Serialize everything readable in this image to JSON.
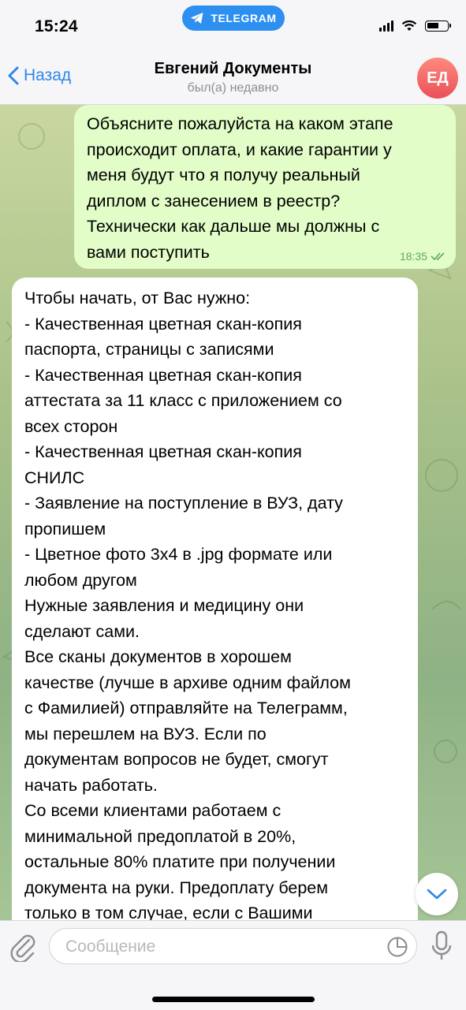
{
  "status_bar": {
    "time": "15:24",
    "app_pill": "TELEGRAM"
  },
  "header": {
    "back_label": "Назад",
    "title": "Евгений Документы",
    "subtitle": "был(а) недавно",
    "avatar_initials": "ЕД"
  },
  "messages": [
    {
      "direction": "outgoing",
      "lines": [
        "Объясните пожалуйста на каком этапе",
        "происходит оплата, и какие гарантии у",
        "меня будут что я получу реальный",
        "диплом с занесением в реестр?",
        "Технически как дальше мы должны с",
        "вами поступить"
      ],
      "time": "18:35",
      "status": "read"
    },
    {
      "direction": "incoming",
      "lines": [
        "Чтобы начать, от Вас нужно:",
        "- Качественная цветная скан-копия",
        "паспорта, страницы с записями",
        "- Качественная цветная скан-копия",
        "аттестата за 11 класс с приложением со",
        "всех сторон",
        "- Качественная цветная скан-копия",
        "СНИЛС",
        "- Заявление на поступление в ВУЗ, дату",
        "пропишем",
        "- Цветное фото 3х4 в .jpg формате или",
        "любом другом",
        "Нужные заявления и медицину они",
        "сделают сами.",
        "Все сканы документов в хорошем",
        "качестве (лучше в архиве одним файлом",
        "с Фамилией) отправляйте на Телеграмм,",
        "мы перешлем на ВУЗ. Если  по",
        "документам вопросов не будет, смогут",
        "начать работать.",
        "Со всеми клиентами работаем с",
        "минимальной предоплатой в 20%,",
        "остальные 80% платите при получении",
        "документа на руки. Предоплату берем",
        "только в том случае, если с Вашими"
      ]
    }
  ],
  "composer": {
    "placeholder": "Сообщение"
  },
  "colors": {
    "accent": "#2f86e8",
    "outgoing_bubble": "#e2fdc8",
    "incoming_bubble": "#ffffff",
    "avatar": "#e9505a"
  },
  "icons": [
    "telegram-plane-icon",
    "back-chevron-icon",
    "double-check-icon",
    "chevron-down-icon",
    "paperclip-icon",
    "sticker-icon",
    "microphone-icon"
  ]
}
